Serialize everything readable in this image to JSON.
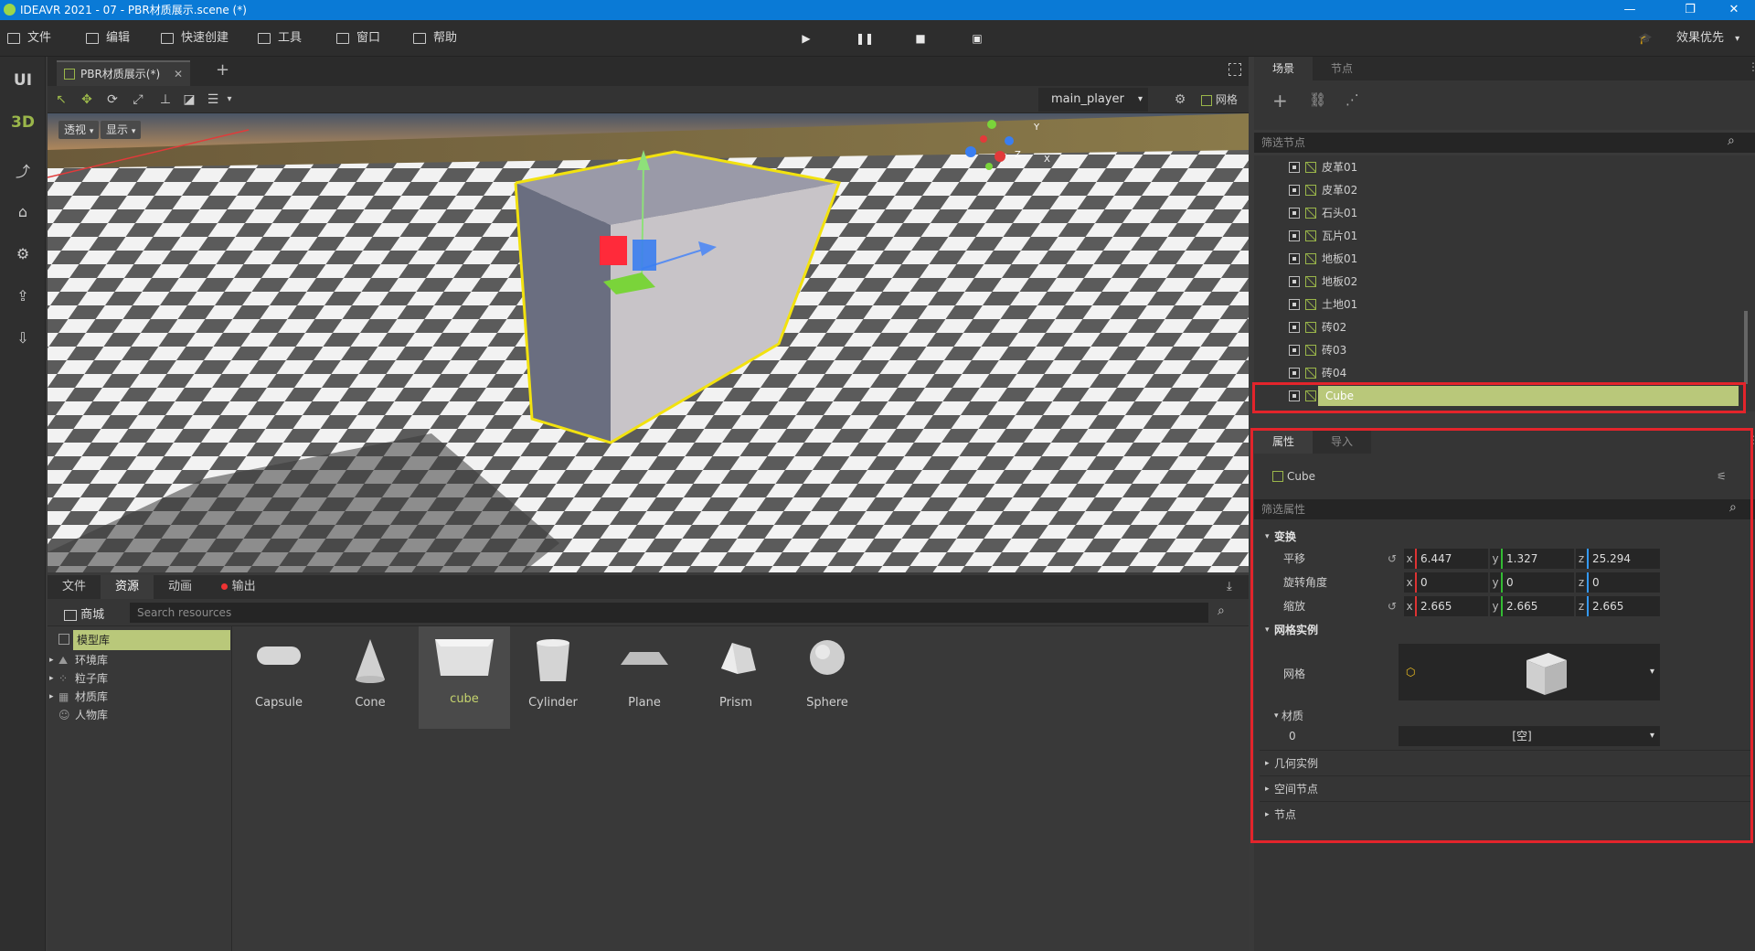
{
  "window": {
    "title": "IDEAVR 2021 - 07 - PBR材质展示.scene (*)",
    "minimize": "—",
    "restore": "❐",
    "close": "✕"
  },
  "menubar": {
    "items": [
      "文件",
      "编辑",
      "快速创建",
      "工具",
      "窗口",
      "帮助"
    ],
    "play_icon": "play-icon",
    "pause_icon": "pause-icon",
    "stop_icon": "stop-icon",
    "record_icon": "record-icon",
    "quality_label": "效果优先"
  },
  "leftbar": {
    "ui_label": "UI",
    "three_d_label": "3D"
  },
  "editor": {
    "doc_tab": "PBR材质展示(*)",
    "add_tab": "+",
    "camera_select": "main_player",
    "grid_label": "网格",
    "view_mode": "透视",
    "display_mode": "显示"
  },
  "gizmo": {
    "y": "Y",
    "x": "X",
    "z": "Z"
  },
  "bottom": {
    "tabs": [
      "文件",
      "资源",
      "动画",
      "输出"
    ],
    "store_label": "商城",
    "search_placeholder": "Search resources",
    "tree": [
      "模型库",
      "环境库",
      "粒子库",
      "材质库",
      "人物库"
    ],
    "assets": [
      "Capsule",
      "Cone",
      "cube",
      "Cylinder",
      "Plane",
      "Prism",
      "Sphere"
    ]
  },
  "scene": {
    "tabs": [
      "场景",
      "节点"
    ],
    "filter_placeholder": "筛选节点",
    "nodes": [
      "皮革01",
      "皮革02",
      "石头01",
      "瓦片01",
      "地板01",
      "地板02",
      "土地01",
      "砖02",
      "砖03",
      "砖04",
      "Cube"
    ]
  },
  "props": {
    "tabs": [
      "属性",
      "导入"
    ],
    "node_name": "Cube",
    "filter_placeholder": "筛选属性",
    "transform_title": "变换",
    "translate_label": "平移",
    "rotate_label": "旋转角度",
    "scale_label": "缩放",
    "translate": {
      "x": "6.447",
      "y": "1.327",
      "z": "25.294"
    },
    "rotate": {
      "x": "0",
      "y": "0",
      "z": "0"
    },
    "scale": {
      "x": "2.665",
      "y": "2.665",
      "z": "2.665"
    },
    "axis_x": "x",
    "axis_y": "y",
    "axis_z": "z",
    "mesh_instance_title": "网格实例",
    "mesh_label": "网格",
    "material_title": "材质",
    "material_index": "0",
    "material_value": "[空]",
    "geometry_title": "几何实例",
    "spatial_title": "空间节点",
    "node_title": "节点"
  },
  "colors": {
    "accent": "#9ab64a",
    "selection": "#b9c87a",
    "highlight_box": "#e3242b",
    "titlebar": "#0a7ad6"
  }
}
